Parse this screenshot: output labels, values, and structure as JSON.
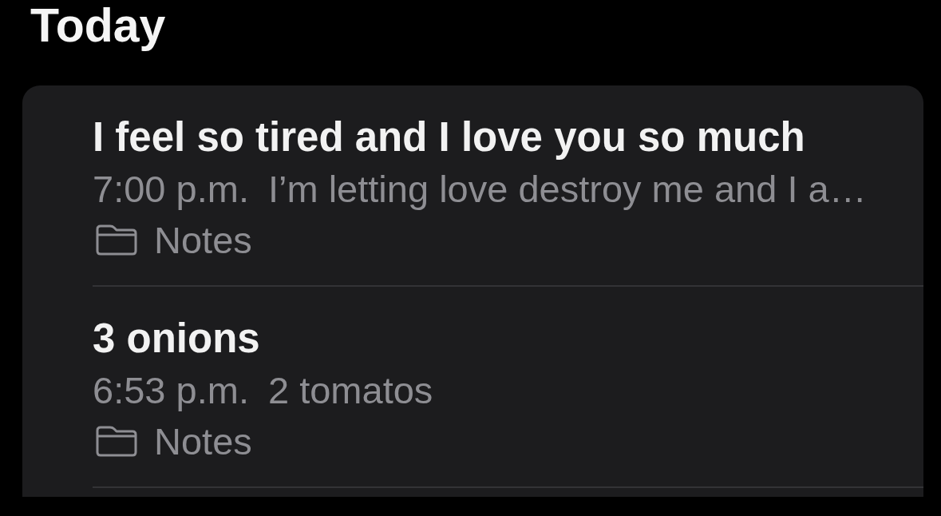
{
  "section_title": "Today",
  "notes": [
    {
      "title": "I feel so tired and I love you so much",
      "time": "7:00 p.m.",
      "preview": "I’m letting love destroy me and I a…",
      "folder": "Notes"
    },
    {
      "title": "3 onions",
      "time": "6:53 p.m.",
      "preview": "2 tomatos",
      "folder": "Notes"
    }
  ]
}
